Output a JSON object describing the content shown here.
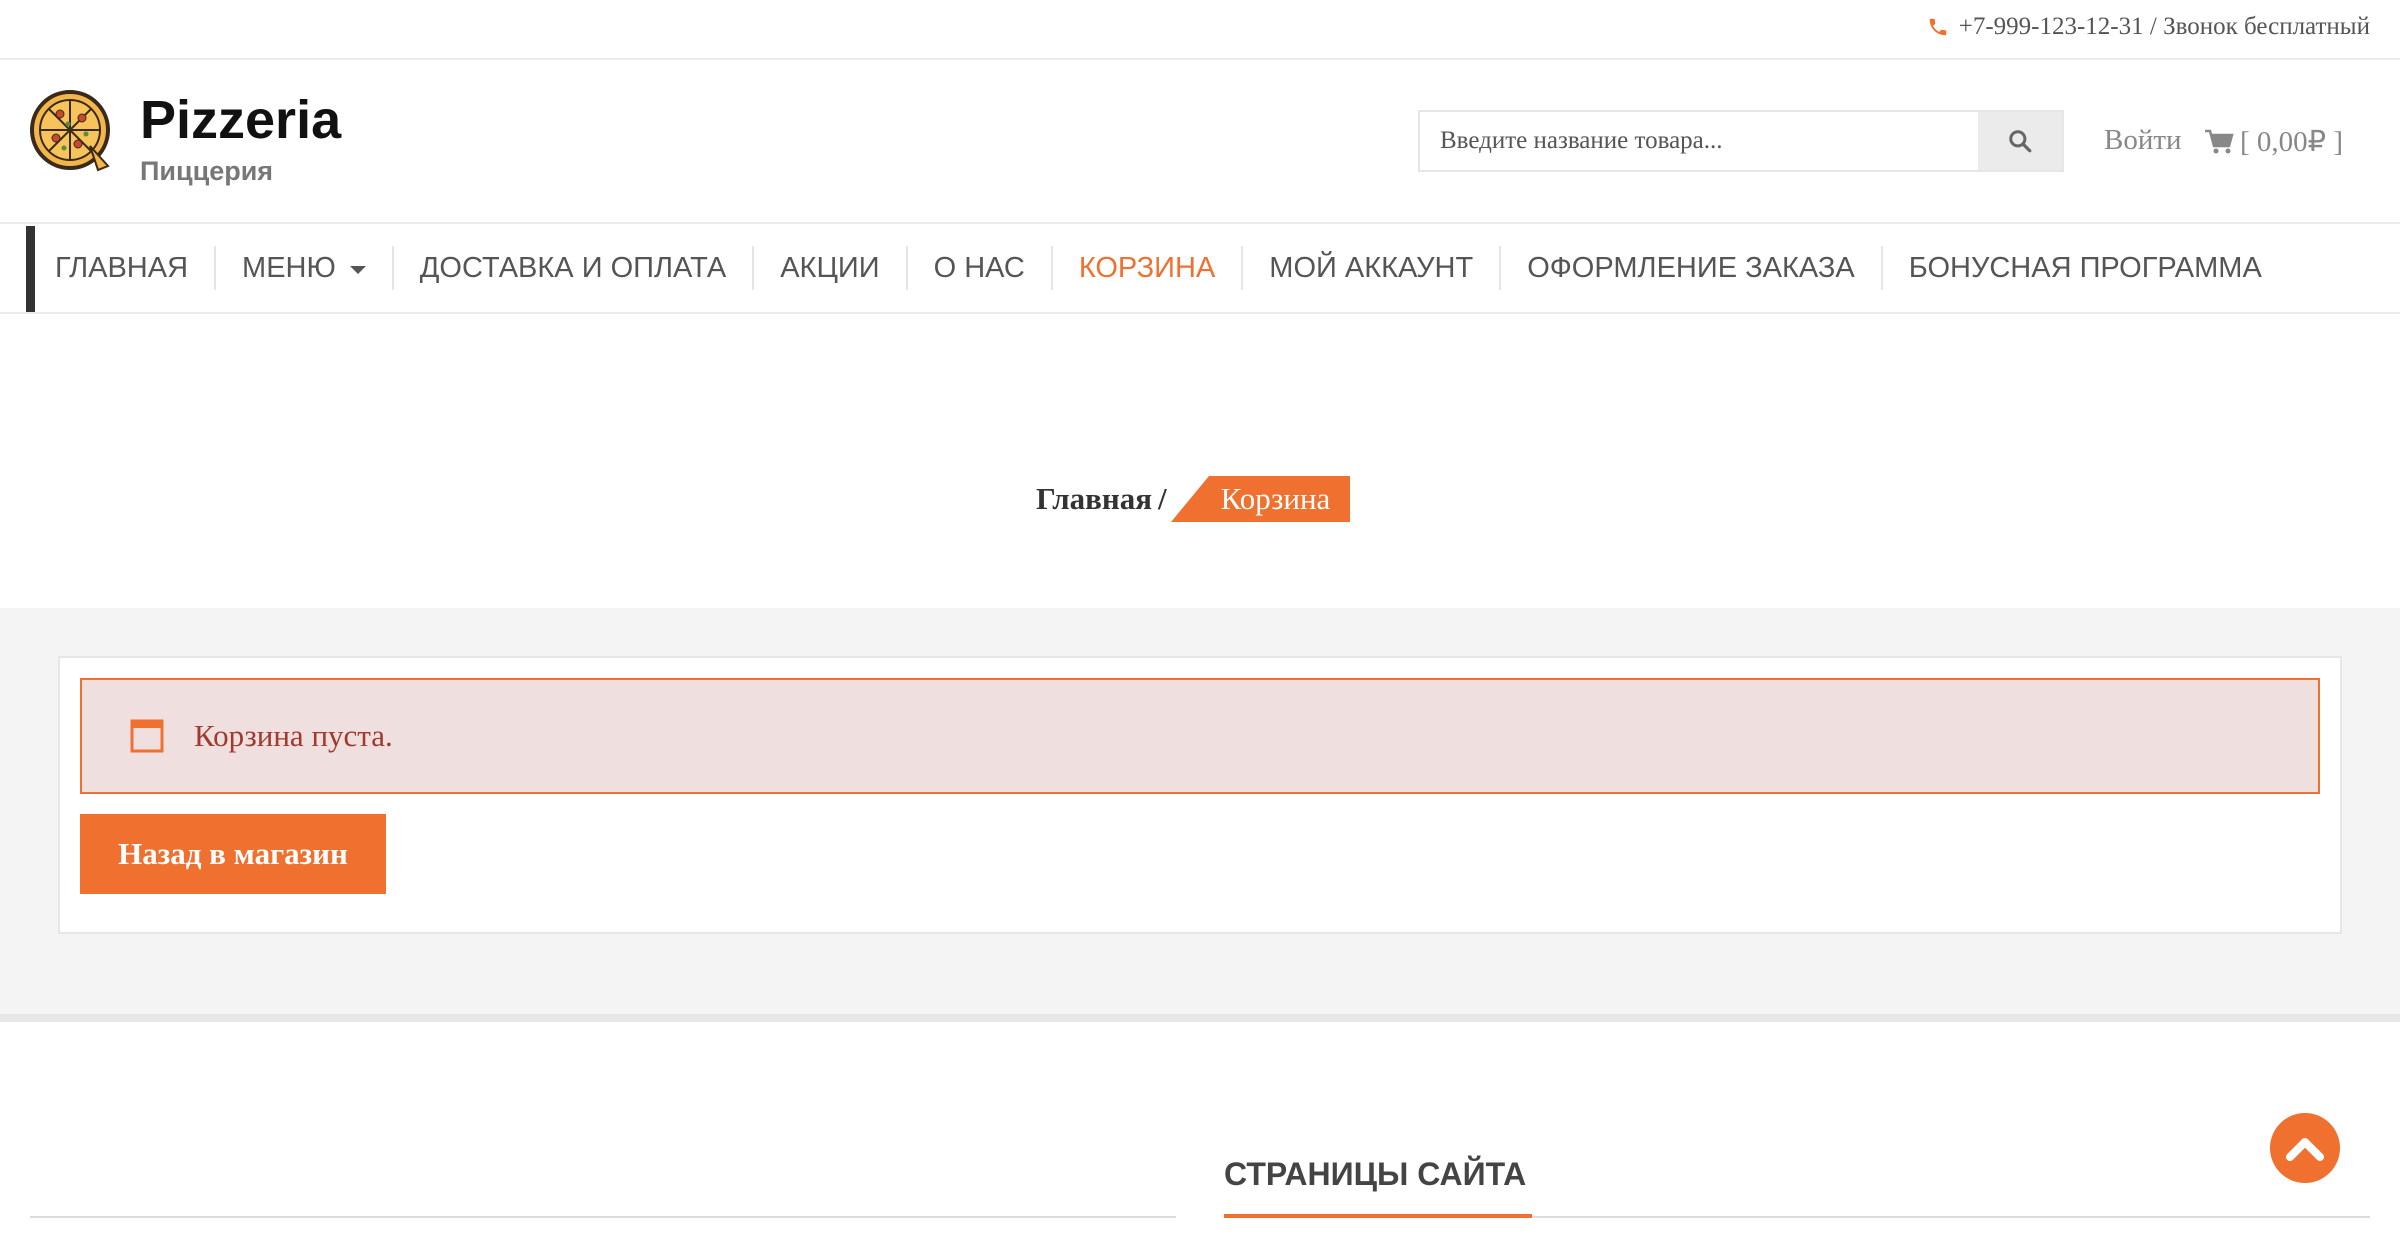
{
  "topbar": {
    "phone_text": "+7-999-123-12-31 / Звонок бесплатный"
  },
  "header": {
    "brand_title": "Pizzeria",
    "brand_subtitle": "Пиццерия",
    "search_placeholder": "Введите название товара...",
    "login_label": "Войти",
    "cart_label": "[ 0,00₽ ]"
  },
  "nav": {
    "items": [
      {
        "label": "ГЛАВНАЯ"
      },
      {
        "label": "МЕНЮ"
      },
      {
        "label": "ДОСТАВКА И ОПЛАТА"
      },
      {
        "label": "АКЦИИ"
      },
      {
        "label": "О НАС"
      },
      {
        "label": "КОРЗИНА"
      },
      {
        "label": "МОЙ АККАУНТ"
      },
      {
        "label": "ОФОРМЛЕНИЕ ЗАКАЗА"
      },
      {
        "label": "БОНУСНАЯ ПРОГРАММА"
      }
    ]
  },
  "breadcrumb": {
    "home": "Главная",
    "separator": "/",
    "current": "Корзина"
  },
  "cart": {
    "empty_notice": "Корзина пуста.",
    "back_button": "Назад в магазин"
  },
  "footer": {
    "pages_heading": "СТРАНИЦЫ САЙТА"
  },
  "colors": {
    "accent": "#f07030",
    "notice_bg": "#efdfdf",
    "notice_text": "#a03a2e"
  }
}
